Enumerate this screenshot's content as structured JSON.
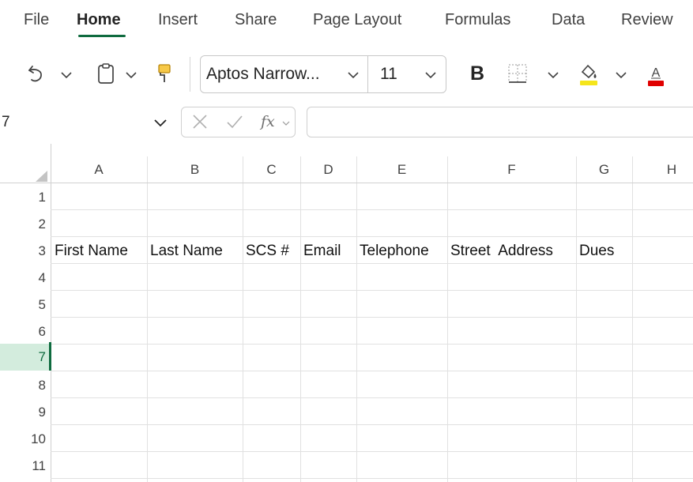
{
  "menu": {
    "tabs": [
      {
        "label": "File"
      },
      {
        "label": "Home"
      },
      {
        "label": "Insert"
      },
      {
        "label": "Share"
      },
      {
        "label": "Page Layout"
      },
      {
        "label": "Formulas"
      },
      {
        "label": "Data"
      },
      {
        "label": "Review"
      }
    ],
    "active_tab": "Home"
  },
  "ribbon": {
    "undo_icon": "undo-icon",
    "clipboard_icon": "clipboard-icon",
    "format_painter_icon": "format-painter-icon",
    "font_name": "Aptos Narrow...",
    "font_size": "11",
    "bold_label": "B",
    "borders_icon": "borders-icon",
    "fill_color_icon": "fill-color-icon",
    "font_color_icon": "font-color-icon",
    "font_color_letter": "A",
    "fill_color": "#f5e51b",
    "font_color": "#e00000"
  },
  "formula_bar": {
    "name_box": "7",
    "fx_label": "fx",
    "formula": ""
  },
  "grid": {
    "columns": [
      "A",
      "B",
      "C",
      "D",
      "E",
      "F",
      "G",
      "H"
    ],
    "rows": [
      "1",
      "2",
      "3",
      "4",
      "5",
      "6",
      "7",
      "8",
      "9",
      "10",
      "11"
    ],
    "selected_row": "7",
    "row3_values": [
      "First Name",
      "Last Name",
      "SCS #",
      "Email",
      "Telephone",
      "Street  Address",
      "Dues"
    ]
  },
  "colors": {
    "accent": "#0f6b3f",
    "selected_header_bg": "#d3ecdd",
    "gridline": "#e1e1e1"
  }
}
